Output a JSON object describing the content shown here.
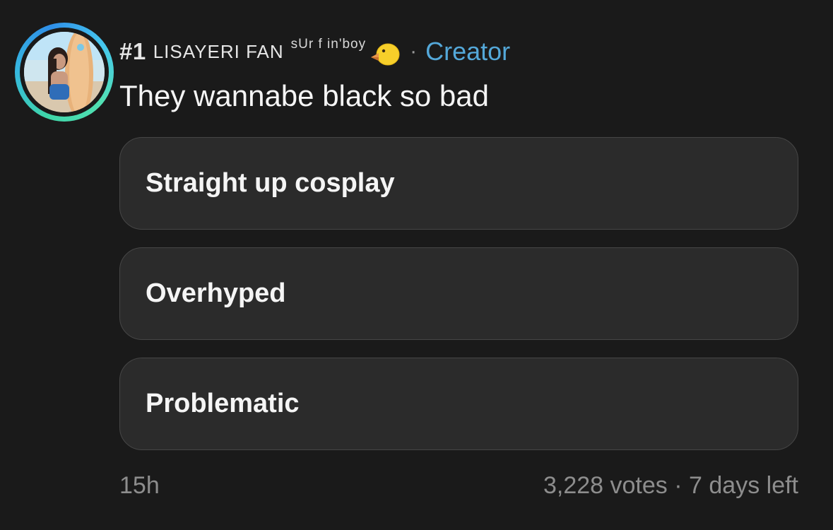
{
  "post": {
    "rank": "#1",
    "display_name": "LISAYERI FAN",
    "name_suffix": "sUr f in'boy",
    "separator": "·",
    "creator_label": "Creator",
    "creator_color": "#54a8d9",
    "badge_icon": "duck-icon",
    "avatar_icon": "avatar-photo",
    "question": "They wannabe black so bad"
  },
  "poll": {
    "options": [
      {
        "label": "Straight up cosplay"
      },
      {
        "label": "Overhyped"
      },
      {
        "label": "Problematic"
      }
    ],
    "vote_count": "3,228 votes",
    "separator": "·",
    "time_left": "7 days left"
  },
  "meta": {
    "timestamp": "15h"
  }
}
